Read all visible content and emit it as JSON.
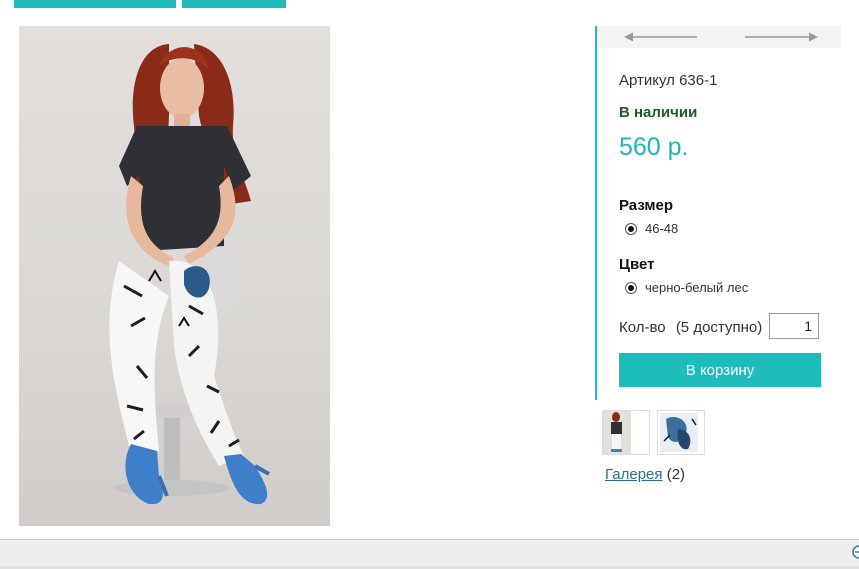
{
  "product": {
    "sku_label": "Артикул 636-1",
    "availability": "В наличии",
    "price": "560 р."
  },
  "options": {
    "size": {
      "title": "Размер",
      "selected": "46-48"
    },
    "color": {
      "title": "Цвет",
      "selected": "черно-белый лес"
    }
  },
  "quantity": {
    "label": "Кол-во",
    "available_text": "(5 доступно)",
    "value": "1"
  },
  "cart": {
    "button_label": "В корзину"
  },
  "gallery": {
    "link_text": "Галерея",
    "count_text": "(2)"
  },
  "icons": {
    "prev": "arrow-left-icon",
    "next": "arrow-right-icon"
  },
  "colors": {
    "accent": "#1fbcbc",
    "price": "#1fb5b5",
    "in_stock": "#1f5a22",
    "link": "#2b6c8c"
  }
}
